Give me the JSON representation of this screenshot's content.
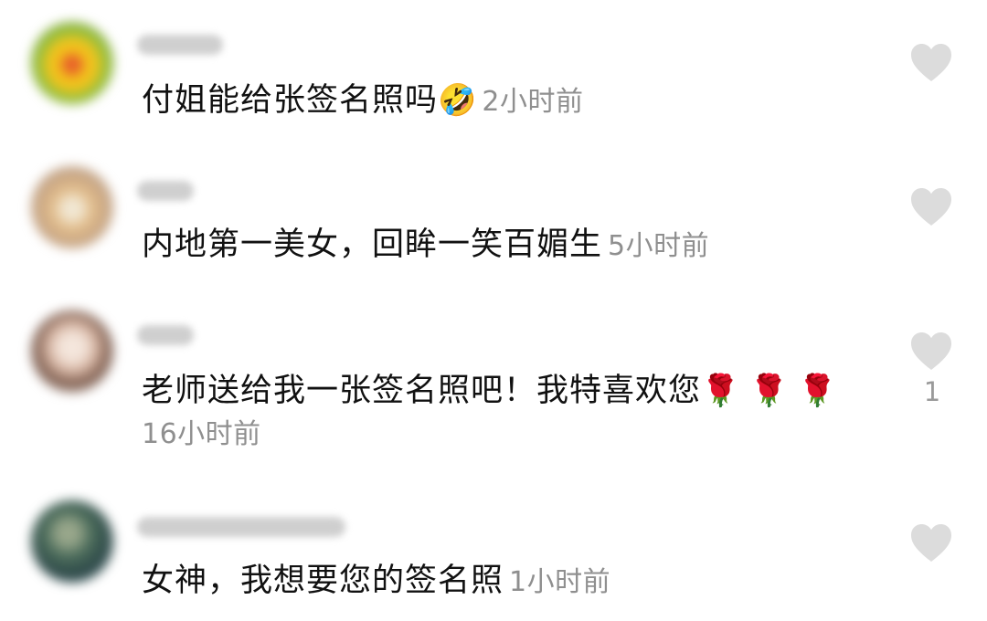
{
  "comments": [
    {
      "text": "付姐能给张签名照吗",
      "emoji": "🤣",
      "time": "2小时前",
      "likes": ""
    },
    {
      "text": "内地第一美女，回眸一笑百媚生",
      "emoji": "",
      "time": "5小时前",
      "likes": ""
    },
    {
      "text": "老师送给我一张签名照吧！我特喜欢您",
      "emoji": "🌹 🌹 🌹",
      "time": "16小时前",
      "likes": "1"
    },
    {
      "text": "女神，我想要您的签名照",
      "emoji": "",
      "time": "1小时前",
      "likes": ""
    }
  ],
  "colors": {
    "heart": "#dcdcdc",
    "timestamp": "#8f8f8f",
    "text": "#111111"
  },
  "icons": {
    "like": "heart-icon",
    "avatar": "blurred-user-avatar"
  }
}
